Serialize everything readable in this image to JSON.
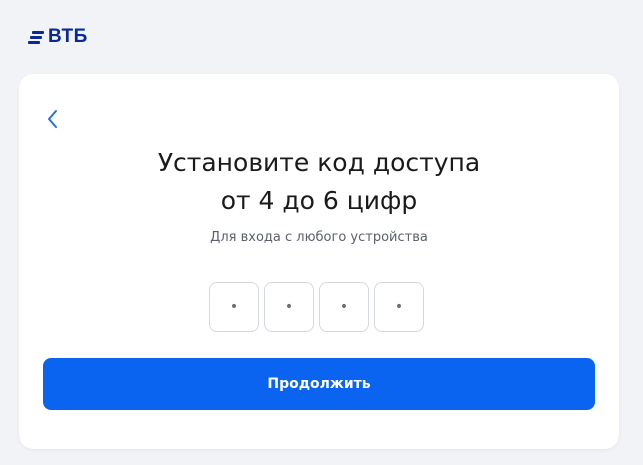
{
  "brand": {
    "name": "ВТБ",
    "color": "#0a2896"
  },
  "card": {
    "back_icon": "chevron-left-icon",
    "title_line1": "Установите код доступа",
    "title_line2": "от 4 до 6 цифр",
    "subtitle": "Для входа с любого устройства",
    "pin_cells": [
      "•",
      "•",
      "•",
      "•"
    ],
    "continue_label": "Продолжить",
    "accent_color": "#0a64f0"
  }
}
